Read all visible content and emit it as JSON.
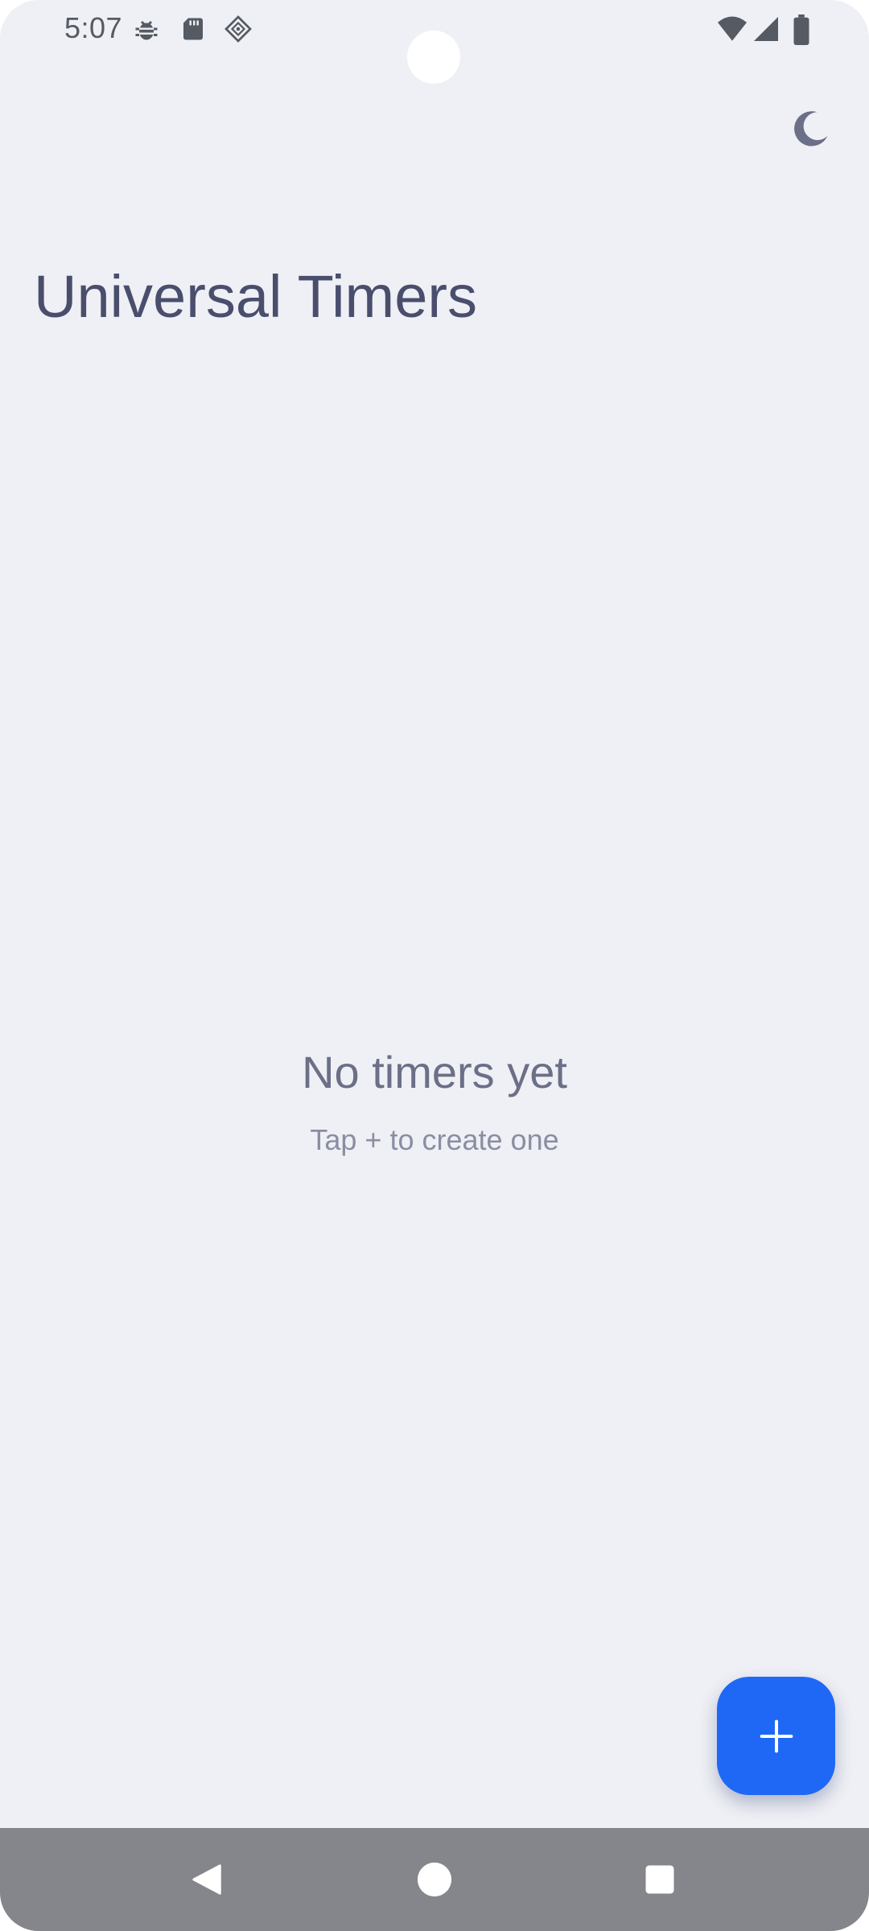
{
  "status_bar": {
    "time": "5:07",
    "left_icons": [
      "bug-icon",
      "sd-card-icon",
      "vpn-diamond-icon"
    ],
    "right_icons": [
      "wifi-icon",
      "signal-icon",
      "battery-icon"
    ]
  },
  "header": {
    "title": "Universal Timers",
    "theme_toggle_icon": "moon-icon"
  },
  "empty_state": {
    "title": "No timers yet",
    "subtitle": "Tap + to create one"
  },
  "fab": {
    "icon": "plus-icon",
    "color": "#1f68f5"
  },
  "nav_bar": {
    "buttons": [
      "back-icon",
      "home-icon",
      "recents-icon"
    ]
  },
  "colors": {
    "background": "#eff0f5",
    "title": "#4a4e6d",
    "accent": "#1f68f5",
    "nav_bar": "#85868b"
  }
}
